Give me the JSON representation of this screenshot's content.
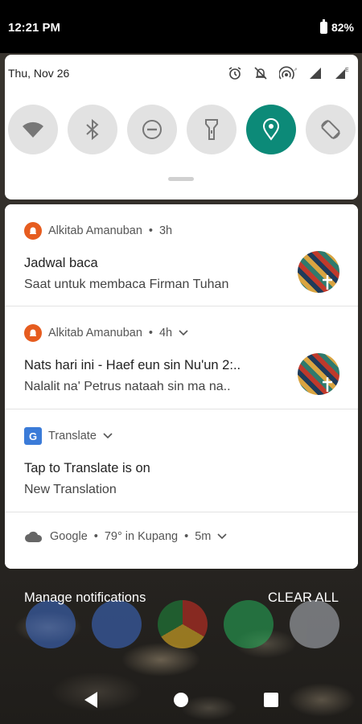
{
  "status_bar": {
    "time": "12:21 PM",
    "battery": "82%"
  },
  "quick_settings": {
    "date": "Thu, Nov 26",
    "tiles": [
      "wifi",
      "bluetooth",
      "do-not-disturb",
      "flashlight",
      "location",
      "auto-rotate"
    ],
    "active_tile": "location",
    "active_color": "#0c8a78"
  },
  "notifications": [
    {
      "app": "Alkitab Amanuban",
      "time": "3h",
      "title": "Jadwal baca",
      "text": "Saat untuk membaca Firman Tuhan",
      "icon_color": "#e65c1f"
    },
    {
      "app": "Alkitab Amanuban",
      "time": "4h",
      "title": "Nats hari ini - Haef eun sin Nu'un 2:..",
      "text": "Nalalit na' Petrus nataah sin ma na..",
      "icon_color": "#e65c1f"
    },
    {
      "app": "Translate",
      "title": "Tap to Translate is on",
      "text": "New Translation",
      "icon_label": "G"
    },
    {
      "app": "Google",
      "detail": "79° in Kupang",
      "time": "5m"
    }
  ],
  "actions": {
    "manage": "Manage notifications",
    "clear_all": "CLEAR ALL"
  }
}
